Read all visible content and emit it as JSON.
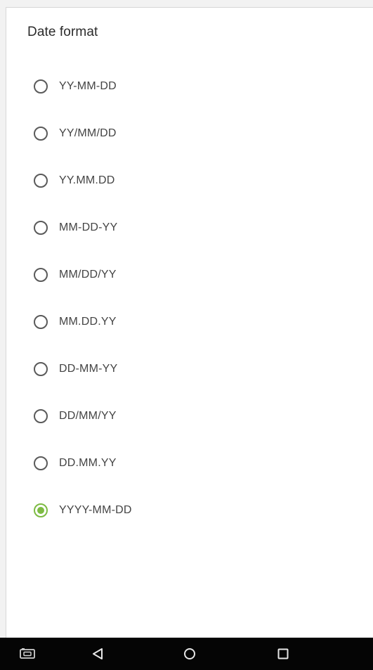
{
  "dialog": {
    "title": "Date format",
    "options": [
      {
        "label": "YY-MM-DD",
        "selected": false
      },
      {
        "label": "YY/MM/DD",
        "selected": false
      },
      {
        "label": "YY.MM.DD",
        "selected": false
      },
      {
        "label": "MM-DD-YY",
        "selected": false
      },
      {
        "label": "MM/DD/YY",
        "selected": false
      },
      {
        "label": "MM.DD.YY",
        "selected": false
      },
      {
        "label": "DD-MM-YY",
        "selected": false
      },
      {
        "label": "DD/MM/YY",
        "selected": false
      },
      {
        "label": "DD.MM.YY",
        "selected": false
      },
      {
        "label": "YYYY-MM-DD",
        "selected": true
      }
    ]
  },
  "navbar": {
    "buttons": [
      {
        "icon": "screenshot-icon"
      },
      {
        "icon": "back-icon"
      },
      {
        "icon": "home-icon"
      },
      {
        "icon": "recents-icon"
      }
    ]
  },
  "colors": {
    "accent": "#7dbb43",
    "navbar_bg": "#050505",
    "text": "#444444"
  }
}
